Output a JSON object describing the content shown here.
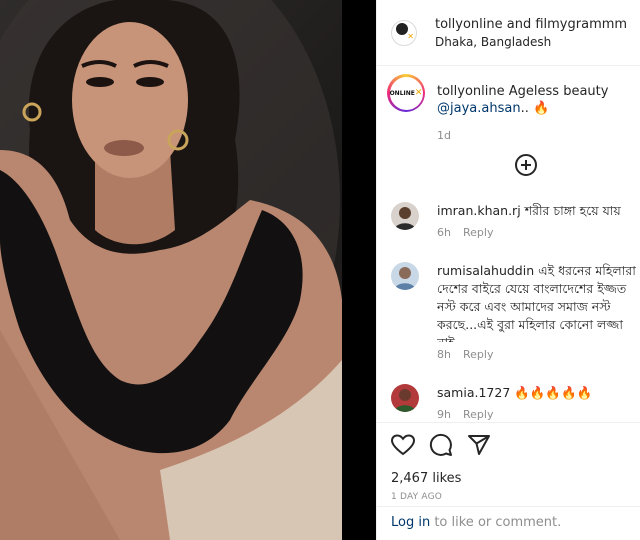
{
  "post": {
    "author": "tollyonline and filmygrammm",
    "location": "Dhaka, Bangladesh",
    "brand_logo_text": "ONLINE"
  },
  "caption": {
    "username": "tollyonline",
    "text": "Ageless beauty",
    "mention": "@jaya.ahsan",
    "suffix": "..",
    "emoji": "🔥",
    "time": "1d"
  },
  "comments": [
    {
      "username": "imran.khan.rj",
      "text": "শরীর চাঙ্গা হয়ে যায়",
      "time": "6h",
      "reply": "Reply"
    },
    {
      "username": "rumisalahuddin",
      "text": "এই ধরনের মহিলারা দেশের বাইরে যেয়ে বাংলাদেশের ইজ্জত নস্ট করে এবং আমাদের সমাজ নস্ট করছে...এই বুরা মহিলার কোনো লজ্জা নাই",
      "time": "8h",
      "reply": "Reply"
    },
    {
      "username": "samia.1727",
      "text": "🔥🔥🔥🔥🔥",
      "time": "9h",
      "reply": "Reply"
    }
  ],
  "stats": {
    "likes": "2,467 likes",
    "ago": "1 DAY AGO"
  },
  "footer": {
    "login_link": "Log in",
    "login_rest": " to like or comment."
  },
  "icons": {
    "like": "heart-icon",
    "comment": "comment-icon",
    "share": "send-icon",
    "load_more": "plus-circle-icon"
  },
  "colors": {
    "link": "#00376b",
    "muted": "#8e8e8e",
    "text": "#262626"
  }
}
